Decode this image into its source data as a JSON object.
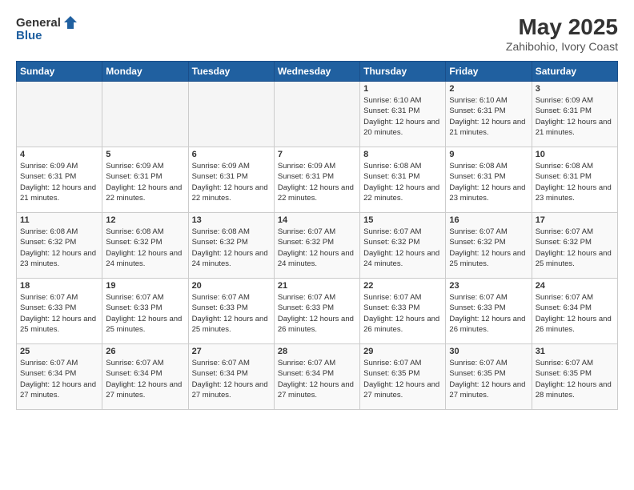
{
  "logo": {
    "general": "General",
    "blue": "Blue"
  },
  "title": "May 2025",
  "subtitle": "Zahibohio, Ivory Coast",
  "days_of_week": [
    "Sunday",
    "Monday",
    "Tuesday",
    "Wednesday",
    "Thursday",
    "Friday",
    "Saturday"
  ],
  "weeks": [
    [
      {
        "day": "",
        "info": ""
      },
      {
        "day": "",
        "info": ""
      },
      {
        "day": "",
        "info": ""
      },
      {
        "day": "",
        "info": ""
      },
      {
        "day": "1",
        "info": "Sunrise: 6:10 AM\nSunset: 6:31 PM\nDaylight: 12 hours\nand 20 minutes."
      },
      {
        "day": "2",
        "info": "Sunrise: 6:10 AM\nSunset: 6:31 PM\nDaylight: 12 hours\nand 21 minutes."
      },
      {
        "day": "3",
        "info": "Sunrise: 6:09 AM\nSunset: 6:31 PM\nDaylight: 12 hours\nand 21 minutes."
      }
    ],
    [
      {
        "day": "4",
        "info": "Sunrise: 6:09 AM\nSunset: 6:31 PM\nDaylight: 12 hours\nand 21 minutes."
      },
      {
        "day": "5",
        "info": "Sunrise: 6:09 AM\nSunset: 6:31 PM\nDaylight: 12 hours\nand 22 minutes."
      },
      {
        "day": "6",
        "info": "Sunrise: 6:09 AM\nSunset: 6:31 PM\nDaylight: 12 hours\nand 22 minutes."
      },
      {
        "day": "7",
        "info": "Sunrise: 6:09 AM\nSunset: 6:31 PM\nDaylight: 12 hours\nand 22 minutes."
      },
      {
        "day": "8",
        "info": "Sunrise: 6:08 AM\nSunset: 6:31 PM\nDaylight: 12 hours\nand 22 minutes."
      },
      {
        "day": "9",
        "info": "Sunrise: 6:08 AM\nSunset: 6:31 PM\nDaylight: 12 hours\nand 23 minutes."
      },
      {
        "day": "10",
        "info": "Sunrise: 6:08 AM\nSunset: 6:31 PM\nDaylight: 12 hours\nand 23 minutes."
      }
    ],
    [
      {
        "day": "11",
        "info": "Sunrise: 6:08 AM\nSunset: 6:32 PM\nDaylight: 12 hours\nand 23 minutes."
      },
      {
        "day": "12",
        "info": "Sunrise: 6:08 AM\nSunset: 6:32 PM\nDaylight: 12 hours\nand 24 minutes."
      },
      {
        "day": "13",
        "info": "Sunrise: 6:08 AM\nSunset: 6:32 PM\nDaylight: 12 hours\nand 24 minutes."
      },
      {
        "day": "14",
        "info": "Sunrise: 6:07 AM\nSunset: 6:32 PM\nDaylight: 12 hours\nand 24 minutes."
      },
      {
        "day": "15",
        "info": "Sunrise: 6:07 AM\nSunset: 6:32 PM\nDaylight: 12 hours\nand 24 minutes."
      },
      {
        "day": "16",
        "info": "Sunrise: 6:07 AM\nSunset: 6:32 PM\nDaylight: 12 hours\nand 25 minutes."
      },
      {
        "day": "17",
        "info": "Sunrise: 6:07 AM\nSunset: 6:32 PM\nDaylight: 12 hours\nand 25 minutes."
      }
    ],
    [
      {
        "day": "18",
        "info": "Sunrise: 6:07 AM\nSunset: 6:33 PM\nDaylight: 12 hours\nand 25 minutes."
      },
      {
        "day": "19",
        "info": "Sunrise: 6:07 AM\nSunset: 6:33 PM\nDaylight: 12 hours\nand 25 minutes."
      },
      {
        "day": "20",
        "info": "Sunrise: 6:07 AM\nSunset: 6:33 PM\nDaylight: 12 hours\nand 25 minutes."
      },
      {
        "day": "21",
        "info": "Sunrise: 6:07 AM\nSunset: 6:33 PM\nDaylight: 12 hours\nand 26 minutes."
      },
      {
        "day": "22",
        "info": "Sunrise: 6:07 AM\nSunset: 6:33 PM\nDaylight: 12 hours\nand 26 minutes."
      },
      {
        "day": "23",
        "info": "Sunrise: 6:07 AM\nSunset: 6:33 PM\nDaylight: 12 hours\nand 26 minutes."
      },
      {
        "day": "24",
        "info": "Sunrise: 6:07 AM\nSunset: 6:34 PM\nDaylight: 12 hours\nand 26 minutes."
      }
    ],
    [
      {
        "day": "25",
        "info": "Sunrise: 6:07 AM\nSunset: 6:34 PM\nDaylight: 12 hours\nand 27 minutes."
      },
      {
        "day": "26",
        "info": "Sunrise: 6:07 AM\nSunset: 6:34 PM\nDaylight: 12 hours\nand 27 minutes."
      },
      {
        "day": "27",
        "info": "Sunrise: 6:07 AM\nSunset: 6:34 PM\nDaylight: 12 hours\nand 27 minutes."
      },
      {
        "day": "28",
        "info": "Sunrise: 6:07 AM\nSunset: 6:34 PM\nDaylight: 12 hours\nand 27 minutes."
      },
      {
        "day": "29",
        "info": "Sunrise: 6:07 AM\nSunset: 6:35 PM\nDaylight: 12 hours\nand 27 minutes."
      },
      {
        "day": "30",
        "info": "Sunrise: 6:07 AM\nSunset: 6:35 PM\nDaylight: 12 hours\nand 27 minutes."
      },
      {
        "day": "31",
        "info": "Sunrise: 6:07 AM\nSunset: 6:35 PM\nDaylight: 12 hours\nand 28 minutes."
      }
    ]
  ]
}
